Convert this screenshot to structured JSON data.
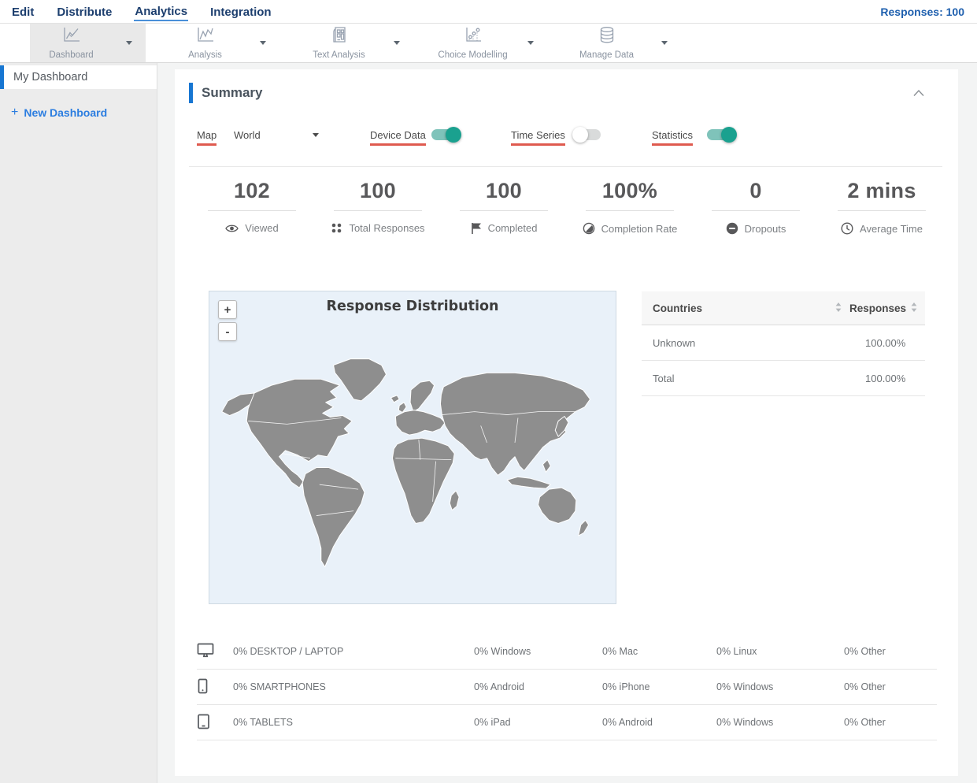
{
  "nav": {
    "items": [
      {
        "label": "Edit"
      },
      {
        "label": "Distribute"
      },
      {
        "label": "Analytics"
      },
      {
        "label": "Integration"
      }
    ],
    "responses_label": "Responses: 100"
  },
  "toolbar": {
    "items": [
      {
        "label": "Dashboard"
      },
      {
        "label": "Analysis"
      },
      {
        "label": "Text Analysis"
      },
      {
        "label": "Choice Modelling"
      },
      {
        "label": "Manage Data"
      }
    ]
  },
  "sidebar": {
    "my_dashboard_label": "My Dashboard",
    "new_dashboard_plus": "+",
    "new_dashboard_label": "New Dashboard"
  },
  "summary": {
    "title": "Summary",
    "controls": {
      "map_label": "Map",
      "map_select_value": "World",
      "device_data_label": "Device Data",
      "device_data_on": true,
      "time_series_label": "Time Series",
      "time_series_on": false,
      "statistics_label": "Statistics",
      "statistics_on": true
    },
    "stats": [
      {
        "value": "102",
        "label": "Viewed",
        "icon": "eye-icon"
      },
      {
        "value": "100",
        "label": "Total Responses",
        "icon": "dots-grid-icon"
      },
      {
        "value": "100",
        "label": "Completed",
        "icon": "flag-icon"
      },
      {
        "value": "100%",
        "label": "Completion Rate",
        "icon": "contrast-circle-icon"
      },
      {
        "value": "0",
        "label": "Dropouts",
        "icon": "minus-circle-icon"
      },
      {
        "value": "2 mins",
        "label": "Average Time",
        "icon": "clock-icon"
      }
    ],
    "map": {
      "title": "Response Distribution",
      "zoom_in": "+",
      "zoom_out": "-"
    },
    "countries_table": {
      "col_countries": "Countries",
      "col_responses": "Responses",
      "rows": [
        {
          "country": "Unknown",
          "responses": "100.00%"
        },
        {
          "country": "Total",
          "responses": "100.00%"
        }
      ]
    },
    "device_table": {
      "rows": [
        {
          "icon": "desktop-icon",
          "label": "0% DESKTOP / LAPTOP",
          "cols": [
            "0% Windows",
            "0% Mac",
            "0% Linux",
            "0% Other"
          ]
        },
        {
          "icon": "smartphone-icon",
          "label": "0% SMARTPHONES",
          "cols": [
            "0% Android",
            "0% iPhone",
            "0% Windows",
            "0% Other"
          ]
        },
        {
          "icon": "tablet-icon",
          "label": "0% TABLETS",
          "cols": [
            "0% iPad",
            "0% Android",
            "0% Windows",
            "0% Other"
          ]
        }
      ]
    }
  },
  "colors": {
    "nav_navy": "#1c3e6e",
    "accent_blue": "#1776d2",
    "link_blue": "#2b7de0",
    "underline_red": "#df5a4f",
    "toggle_on_knob": "#1aa18f",
    "toggle_on_track": "#7fc3ba",
    "map_background": "#e9f1f9",
    "map_land_gray": "#8e8e8e"
  }
}
